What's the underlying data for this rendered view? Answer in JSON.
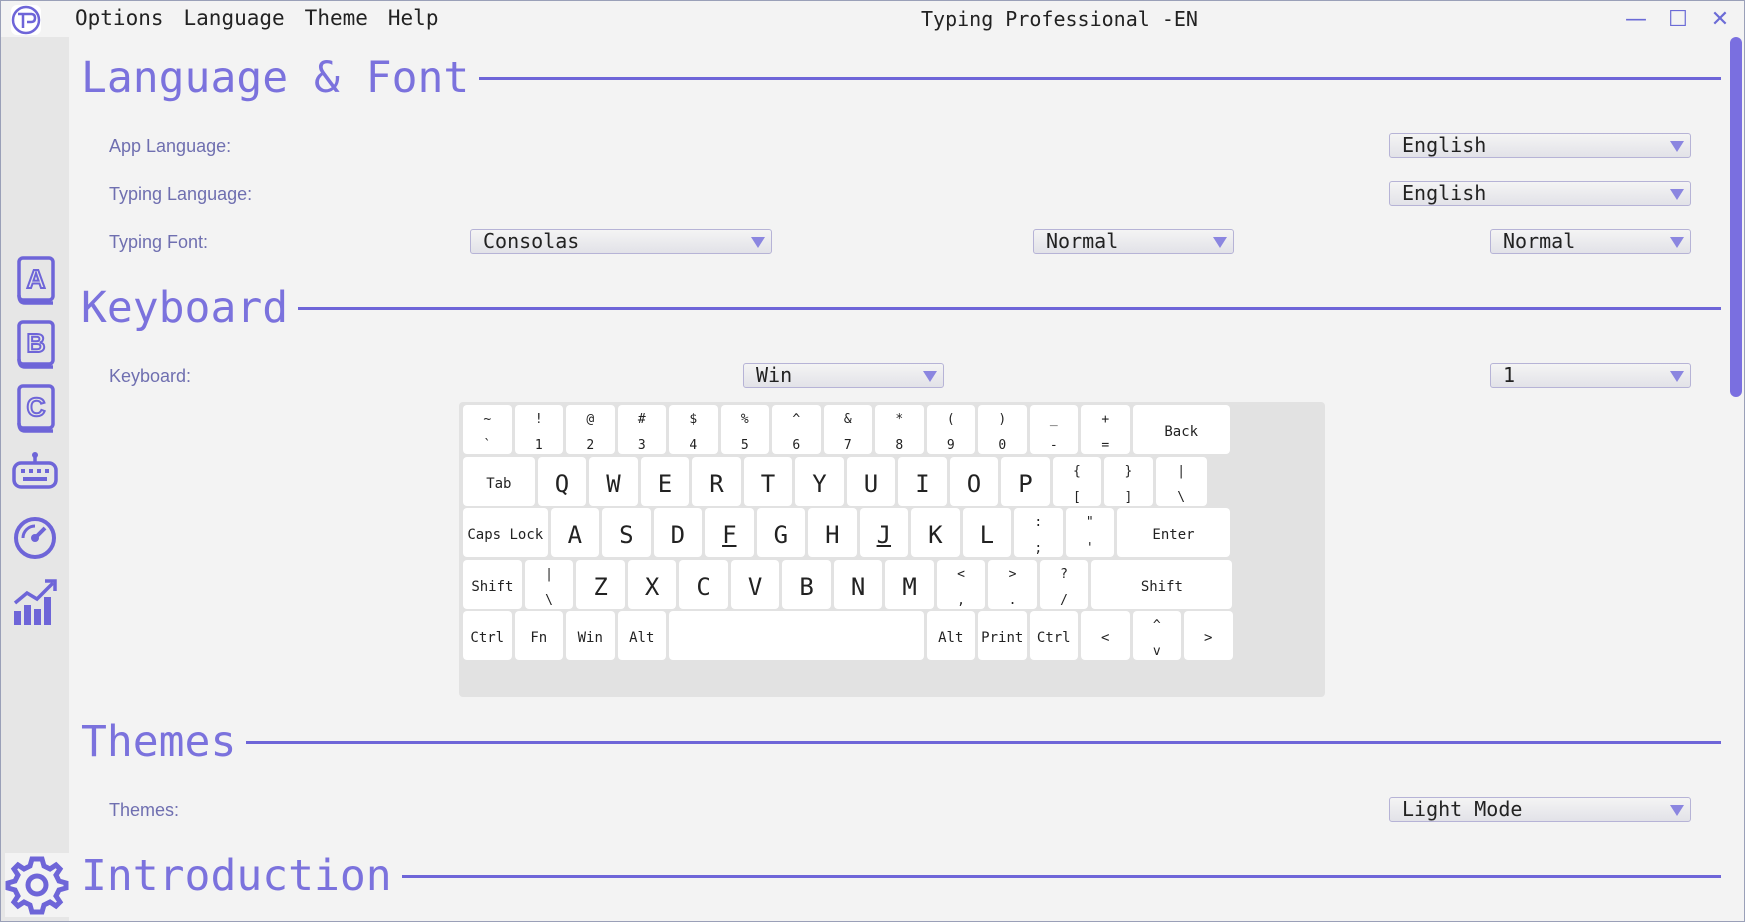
{
  "window": {
    "title": "Typing Professional -EN",
    "menu": [
      "Options",
      "Language",
      "Theme",
      "Help"
    ],
    "controls": {
      "minimize": "—",
      "maximize": "☐",
      "close": "✕"
    }
  },
  "accent": "#7b72dd",
  "sidebar": {
    "items": [
      {
        "name": "book-a-icon",
        "letter": "A"
      },
      {
        "name": "book-b-icon",
        "letter": "B"
      },
      {
        "name": "book-c-icon",
        "letter": "C"
      },
      {
        "name": "keyboard-icon"
      },
      {
        "name": "speedometer-icon"
      },
      {
        "name": "stats-chart-icon"
      }
    ],
    "settings": "gear-icon"
  },
  "sections": {
    "language_font": {
      "title": "Language & Font",
      "app_language": {
        "label": "App Language:",
        "value": "English"
      },
      "typing_language": {
        "label": "Typing Language:",
        "value": "English"
      },
      "typing_font": {
        "label": "Typing Font:",
        "font": "Consolas",
        "weight": "Normal",
        "style": "Normal"
      }
    },
    "keyboard": {
      "title": "Keyboard",
      "label": "Keyboard:",
      "layout": "Win",
      "variant": "1"
    },
    "themes": {
      "title": "Themes",
      "label": "Themes:",
      "value": "Light Mode"
    },
    "introduction": {
      "title": "Introduction"
    }
  },
  "keyboard_rows": [
    [
      {
        "t": "~",
        "b": "`"
      },
      {
        "t": "!",
        "b": "1"
      },
      {
        "t": "@",
        "b": "2"
      },
      {
        "t": "#",
        "b": "3"
      },
      {
        "t": "$",
        "b": "4"
      },
      {
        "t": "%",
        "b": "5"
      },
      {
        "t": "^",
        "b": "6"
      },
      {
        "t": "&",
        "b": "7"
      },
      {
        "t": "*",
        "b": "8"
      },
      {
        "t": "(",
        "b": "9"
      },
      {
        "t": ")",
        "b": "0"
      },
      {
        "t": "_",
        "b": "-"
      },
      {
        "t": "+",
        "b": "="
      },
      {
        "w": "Back"
      }
    ],
    [
      {
        "w": "Tab"
      },
      {
        "l": "Q"
      },
      {
        "l": "W"
      },
      {
        "l": "E"
      },
      {
        "l": "R"
      },
      {
        "l": "T"
      },
      {
        "l": "Y"
      },
      {
        "l": "U"
      },
      {
        "l": "I"
      },
      {
        "l": "O"
      },
      {
        "l": "P"
      },
      {
        "t": "{",
        "b": "["
      },
      {
        "t": "}",
        "b": "]"
      },
      {
        "t": "|",
        "b": "\\"
      }
    ],
    [
      {
        "w": "Caps Lock"
      },
      {
        "l": "A"
      },
      {
        "l": "S"
      },
      {
        "l": "D"
      },
      {
        "l": "F"
      },
      {
        "l": "G"
      },
      {
        "l": "H"
      },
      {
        "l": "J"
      },
      {
        "l": "K"
      },
      {
        "l": "L"
      },
      {
        "t": ":",
        "b": ";"
      },
      {
        "t": "\"",
        "b": "'"
      },
      {
        "w": "Enter"
      }
    ],
    [
      {
        "w": "Shift"
      },
      {
        "t": "|",
        "b": "\\"
      },
      {
        "l": "Z"
      },
      {
        "l": "X"
      },
      {
        "l": "C"
      },
      {
        "l": "V"
      },
      {
        "l": "B"
      },
      {
        "l": "N"
      },
      {
        "l": "M"
      },
      {
        "t": "<",
        "b": ","
      },
      {
        "t": ">",
        "b": "."
      },
      {
        "t": "?",
        "b": "/"
      },
      {
        "w": "Shift"
      }
    ],
    [
      {
        "w": "Ctrl"
      },
      {
        "w": "Fn"
      },
      {
        "w": "Win"
      },
      {
        "w": "Alt"
      },
      {
        "w": ""
      },
      {
        "w": "Alt"
      },
      {
        "w": "Print"
      },
      {
        "w": "Ctrl"
      },
      {
        "w": "<"
      },
      {
        "t": "^",
        "b": "v"
      },
      {
        "w": ">"
      }
    ]
  ]
}
